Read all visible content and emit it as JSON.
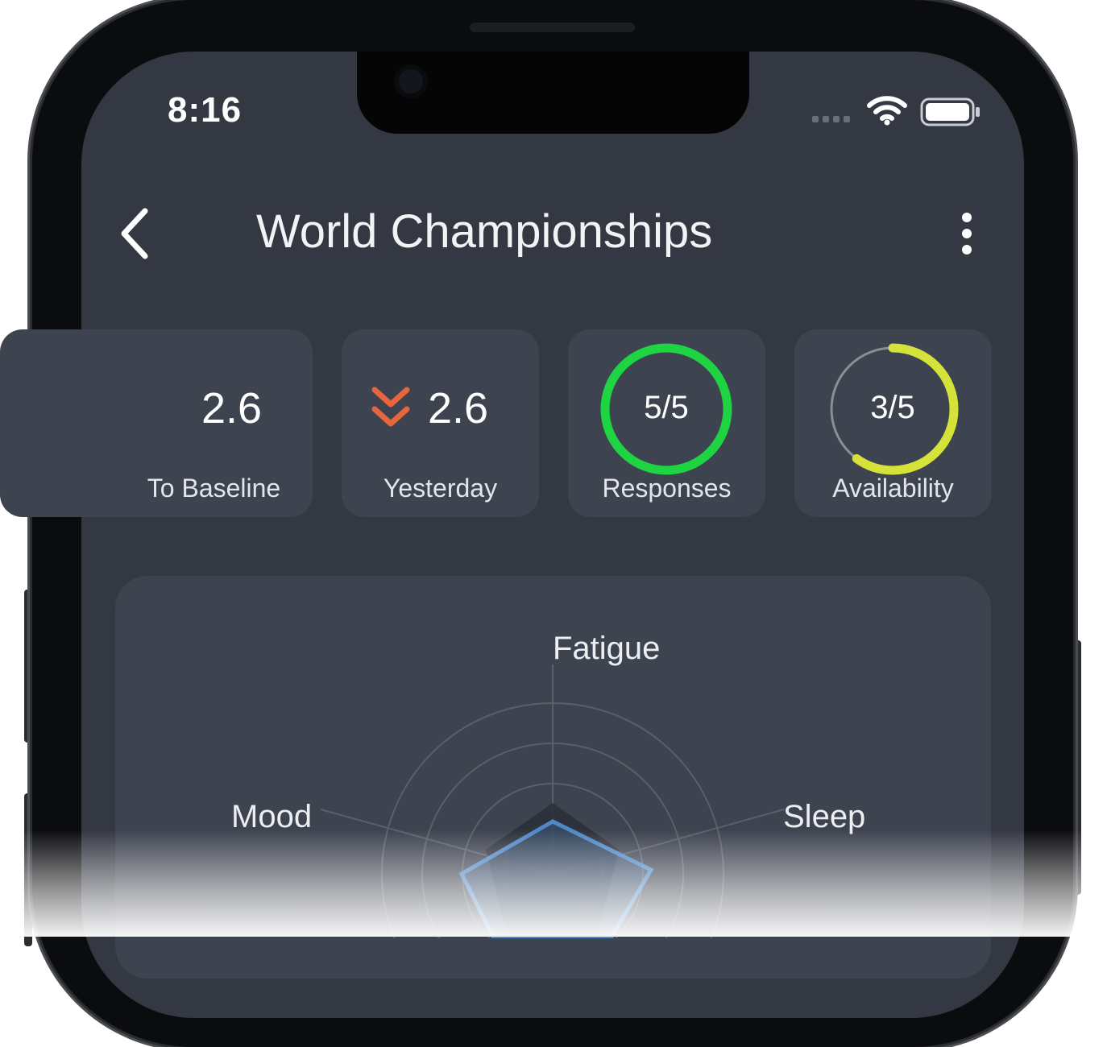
{
  "status_bar": {
    "time": "8:16"
  },
  "header": {
    "title": "World Championships"
  },
  "stats": {
    "to_baseline": {
      "value": "2.6",
      "label": "To Baseline"
    },
    "yesterday": {
      "value": "2.6",
      "label": "Yesterday"
    },
    "responses": {
      "value": "5/5",
      "label": "Responses",
      "fraction": 1.0,
      "color": "#1fd443"
    },
    "availability": {
      "value": "3/5",
      "label": "Availability",
      "fraction": 0.6,
      "color": "#d4e23a"
    }
  },
  "radar": {
    "axes": {
      "fatigue": "Fatigue",
      "mood": "Mood",
      "sleep": "Sleep"
    },
    "series_color": "#4f88c6"
  },
  "colors": {
    "trend_down": "#e8663e",
    "screen_bg": "#343843",
    "card_bg": "#3e4350"
  }
}
